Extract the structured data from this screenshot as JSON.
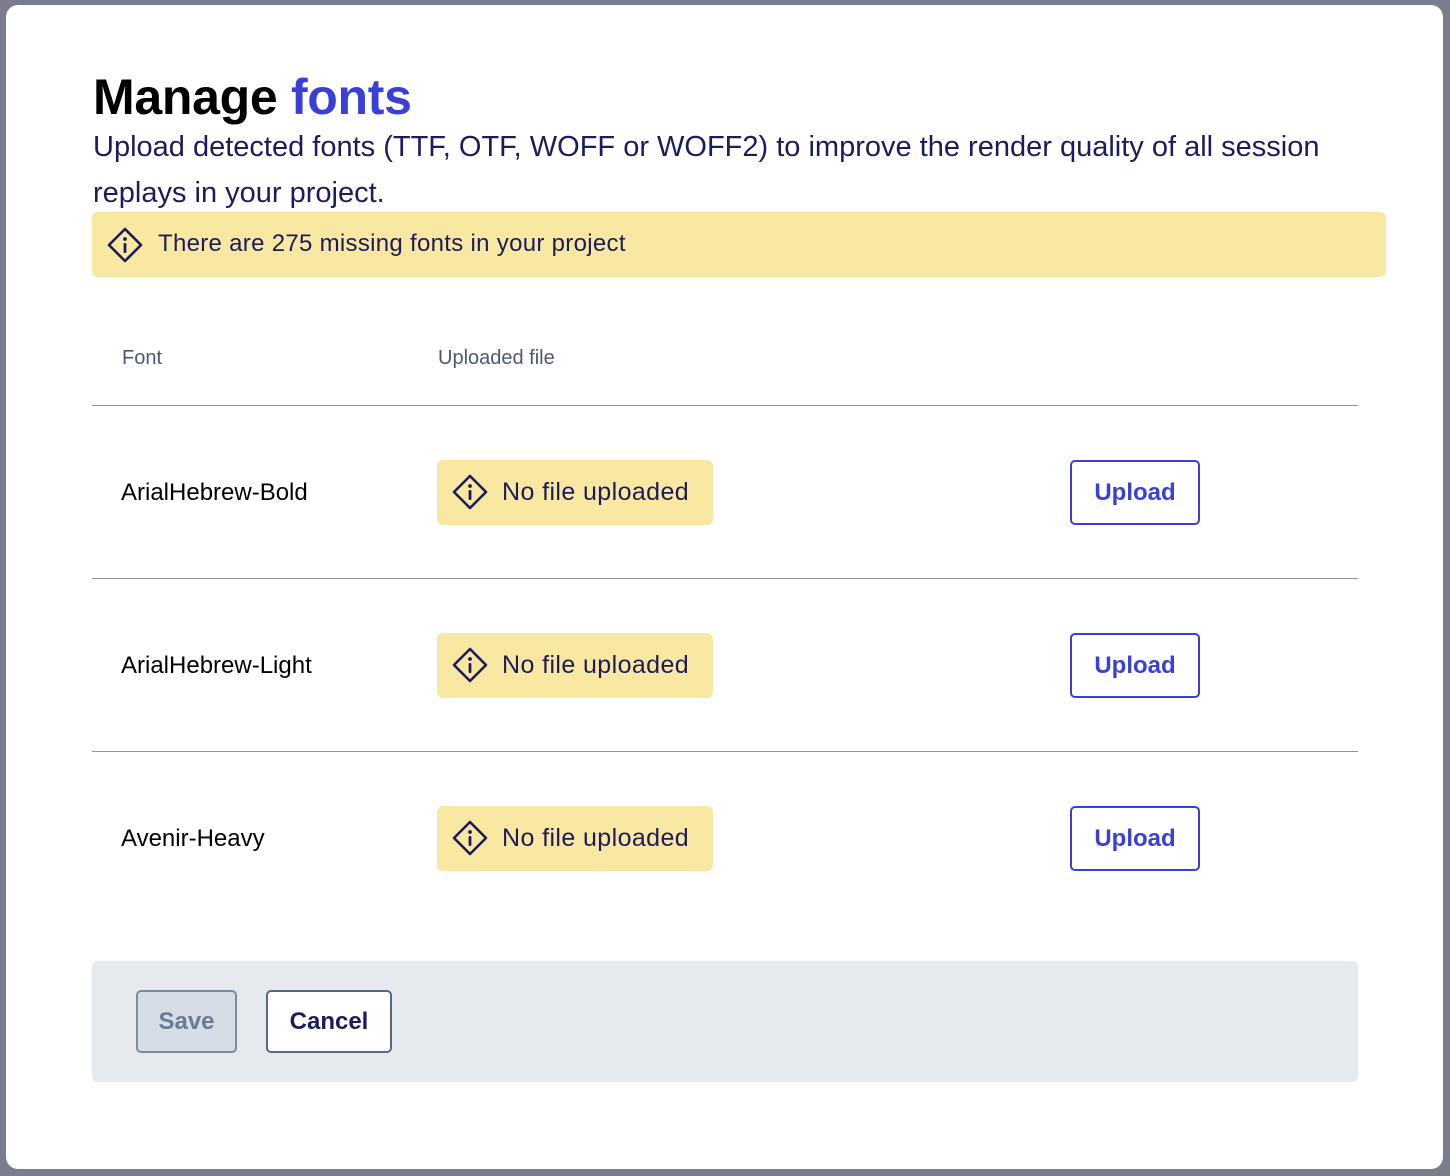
{
  "dialog": {
    "title_main": "Manage",
    "title_accent": "fonts",
    "subtitle": "Upload detected fonts (TTF, OTF, WOFF or WOFF2) to improve the render quality of all session replays in your project."
  },
  "banner": {
    "icon": "info-diamond-icon",
    "text": "There are 275 missing fonts in your project"
  },
  "table": {
    "headers": [
      "Font",
      "Uploaded file"
    ],
    "rows": [
      {
        "font": "ArialHebrew-Bold",
        "status": "No file uploaded",
        "action": "Upload"
      },
      {
        "font": "ArialHebrew-Light",
        "status": "No file uploaded",
        "action": "Upload"
      },
      {
        "font": "Avenir-Heavy",
        "status": "No file uploaded",
        "action": "Upload"
      }
    ]
  },
  "footer": {
    "save_label": "Save",
    "cancel_label": "Cancel"
  },
  "colors": {
    "accent": "#3a3fd6",
    "warning_bg": "#f9e8a2",
    "text_dark": "#1d1b5c",
    "footer_bg": "#e6e9ee",
    "overlay": "#7b7d8c"
  }
}
